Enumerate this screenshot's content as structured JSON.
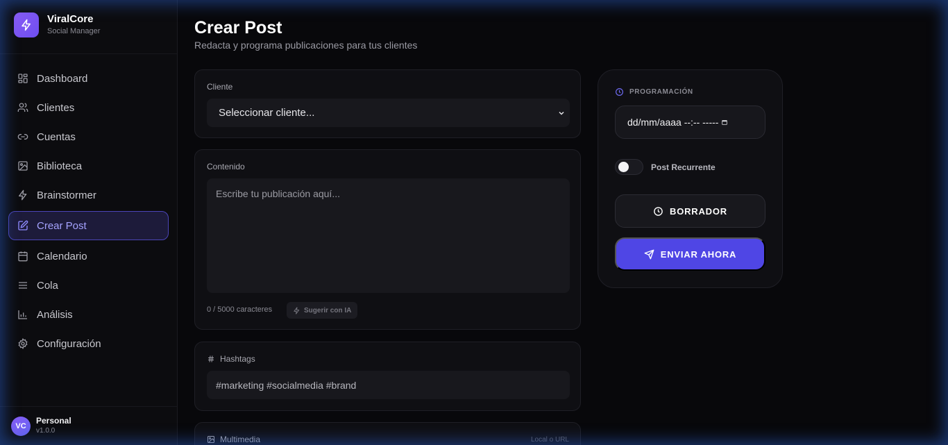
{
  "brand": {
    "name": "ViralCore",
    "subtitle": "Social Manager"
  },
  "nav": [
    {
      "label": "Dashboard",
      "icon": "dashboard-icon"
    },
    {
      "label": "Clientes",
      "icon": "users-icon"
    },
    {
      "label": "Cuentas",
      "icon": "link-icon"
    },
    {
      "label": "Biblioteca",
      "icon": "image-icon"
    },
    {
      "label": "Brainstormer",
      "icon": "lightning-icon"
    },
    {
      "label": "Crear Post",
      "icon": "edit-icon",
      "active": true
    },
    {
      "label": "Calendario",
      "icon": "calendar-icon"
    },
    {
      "label": "Cola",
      "icon": "queue-icon"
    },
    {
      "label": "Análisis",
      "icon": "bar-chart-icon"
    },
    {
      "label": "Configuración",
      "icon": "gear-icon"
    }
  ],
  "user": {
    "initials": "VC",
    "name": "Personal",
    "version": "v1.0.0"
  },
  "page": {
    "title": "Crear Post",
    "subtitle": "Redacta y programa publicaciones para tus clientes"
  },
  "client": {
    "label": "Cliente",
    "selected": "Seleccionar cliente..."
  },
  "content": {
    "label": "Contenido",
    "placeholder": "Escribe tu publicación aquí...",
    "char_count": "0 / 5000 caracteres",
    "ai_button": "Sugerir con IA"
  },
  "hashtags": {
    "label": "Hashtags",
    "value": "#marketing #socialmedia #brand"
  },
  "media": {
    "label": "Multimedia",
    "hint": "Local o URL"
  },
  "schedule": {
    "label": "PROGRAMACIÓN",
    "date_placeholder": "dd/mm/aaaa --:-- -----",
    "recurring_label": "Post Recurrente",
    "recurring_on": false,
    "draft_button": "BORRADOR",
    "send_button": "ENVIAR AHORA"
  },
  "colors": {
    "accent": "#4f46e5",
    "brand": "#7c5cf5",
    "active_nav_text": "#a5a3ff"
  }
}
